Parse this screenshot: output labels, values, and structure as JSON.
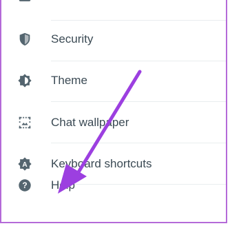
{
  "settings_menu": {
    "items": [
      {
        "label": "Security",
        "icon": "shield-icon"
      },
      {
        "label": "Theme",
        "icon": "theme-icon"
      },
      {
        "label": "Chat wallpaper",
        "icon": "wallpaper-icon"
      },
      {
        "label": "Keyboard shortcuts",
        "icon": "keyboard-icon"
      },
      {
        "label": "Help",
        "icon": "help-icon"
      }
    ],
    "icon_color": "#54656f",
    "text_color": "#3b4a54",
    "divider_color": "#e9edef"
  },
  "annotation": {
    "arrow_color": "#9c3fe0",
    "points_to": "Help"
  },
  "frame_border_color": "#b46ad8"
}
